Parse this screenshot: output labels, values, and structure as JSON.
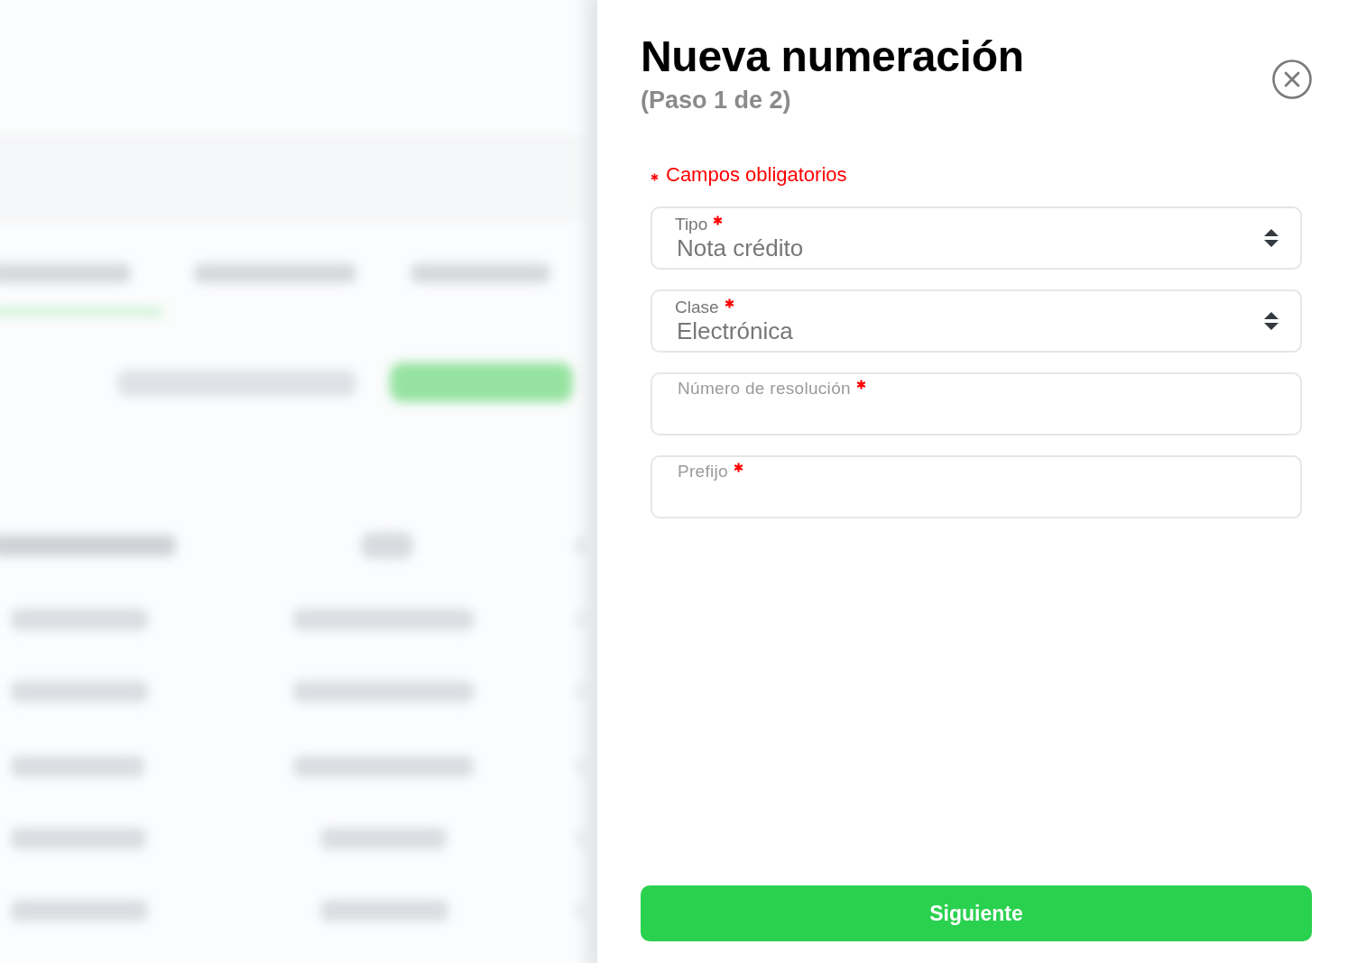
{
  "panel": {
    "title": "Nueva numeración",
    "step": "(Paso 1 de 2)",
    "required_note": "Campos obligatorios",
    "fields": [
      {
        "kind": "select",
        "label": "Tipo",
        "required": true,
        "value": "Nota crédito"
      },
      {
        "kind": "select",
        "label": "Clase",
        "required": true,
        "value": "Electrónica"
      },
      {
        "kind": "text",
        "label": "Número de resolución",
        "required": true
      },
      {
        "kind": "text",
        "label": "Prefijo",
        "required": true
      }
    ],
    "next_button": "Siguiente"
  }
}
